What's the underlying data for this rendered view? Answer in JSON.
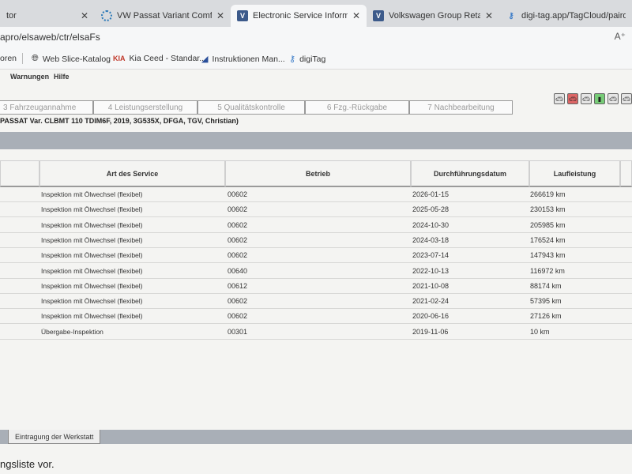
{
  "browser": {
    "tabs": [
      {
        "title": "tor",
        "icon": "blank"
      },
      {
        "title": "VW Passat Variant Comfortline TD",
        "icon": "loading-icon"
      },
      {
        "title": "Electronic Service Information Syst",
        "icon": "v-icon"
      },
      {
        "title": "Volkswagen Group Retail Portal",
        "icon": "v-icon"
      },
      {
        "title": "digi-tag.app/TagCloud/pairdevice",
        "icon": "digitag-icon"
      }
    ],
    "address": "apro/elsaweb/ctr/elsaFs",
    "reader": "A⁺",
    "bookmarks": [
      {
        "label": "oren",
        "icon": ""
      },
      {
        "label": "Web Slice-Katalog",
        "icon": "globe-icon"
      },
      {
        "label": "Kia Ceed - Standar...",
        "icon": "kia-icon"
      },
      {
        "label": "Instruktionen Man...",
        "icon": "manual-icon"
      },
      {
        "label": "digiTag",
        "icon": "digitag-icon"
      }
    ]
  },
  "menu": {
    "warnings": "Warnungen",
    "help": "Hilfe"
  },
  "workflow": [
    "3 Fahrzeugannahme",
    "4 Leistungserstellung",
    "5 Qualitätskontrolle",
    "6 Fzg.-Rückgabe",
    "7 Nachbearbeitung"
  ],
  "vehicle": "PASSAT Var. CLBMT 110 TDIM6F, 2019, 3G535X, DFGA, TGV, Christian)",
  "table": {
    "headers": [
      "Art des Service",
      "Betrieb",
      "Durchführungsdatum",
      "Laufleistung"
    ],
    "rows": [
      [
        "Inspektion mit Ölwechsel (flexibel)",
        "00602",
        "2026-01-15",
        "266619 km"
      ],
      [
        "Inspektion mit Ölwechsel (flexibel)",
        "00602",
        "2025-05-28",
        "230153 km"
      ],
      [
        "Inspektion mit Ölwechsel (flexibel)",
        "00602",
        "2024-10-30",
        "205985 km"
      ],
      [
        "Inspektion mit Ölwechsel (flexibel)",
        "00602",
        "2024-03-18",
        "176524 km"
      ],
      [
        "Inspektion mit Ölwechsel (flexibel)",
        "00602",
        "2023-07-14",
        "147943 km"
      ],
      [
        "Inspektion mit Ölwechsel (flexibel)",
        "00640",
        "2022-10-13",
        "116972 km"
      ],
      [
        "Inspektion mit Ölwechsel (flexibel)",
        "00612",
        "2021-10-08",
        "88174 km"
      ],
      [
        "Inspektion mit Ölwechsel (flexibel)",
        "00602",
        "2021-02-24",
        "57395 km"
      ],
      [
        "Inspektion mit Ölwechsel (flexibel)",
        "00602",
        "2020-06-16",
        "27126 km"
      ],
      [
        "Übergabe-Inspektion",
        "00301",
        "2019-11-06",
        "10 km"
      ]
    ]
  },
  "bottom_tab": "Eintragung der Werkstatt",
  "footer": "ngsliste vor."
}
